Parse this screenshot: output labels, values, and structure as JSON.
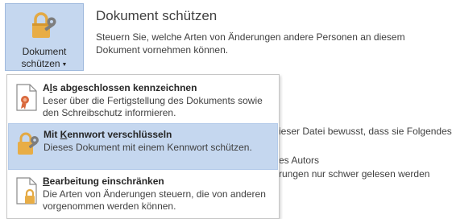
{
  "button": {
    "label_line1": "Dokument",
    "label_line2": "schützen",
    "icon": "lock-key-icon"
  },
  "header": {
    "title": "Dokument schützen",
    "description": "Steuern Sie, welche Arten von Änderungen andere Personen an diesem Dokument vornehmen können."
  },
  "background_fragments": {
    "line1": "ieser Datei bewusst, dass sie Folgendes",
    "line2": "es Autors",
    "line3": "rungen nur schwer gelesen werden"
  },
  "menu": {
    "items": [
      {
        "title_pre": "A",
        "title_acc": "l",
        "title_post": "s abgeschlossen kennzeichnen",
        "description": "Leser über die Fertigstellung des Dokuments sowie den Schreibschutz informieren.",
        "icon": "document-ribbon-icon"
      },
      {
        "title_pre": "Mit ",
        "title_acc": "K",
        "title_post": "ennwort verschlüsseln",
        "description": "Dieses Dokument mit einem Kennwort schützen.",
        "icon": "lock-key-icon"
      },
      {
        "title_pre": "",
        "title_acc": "B",
        "title_post": "earbeitung einschränken",
        "description": "Die Arten von Änderungen steuern, die von anderen vorgenommen werden können.",
        "icon": "document-lock-icon"
      }
    ]
  },
  "colors": {
    "highlight": "#c5d7ef",
    "lock_gold": "#e8ad46",
    "key_gray": "#7a7a7a"
  }
}
